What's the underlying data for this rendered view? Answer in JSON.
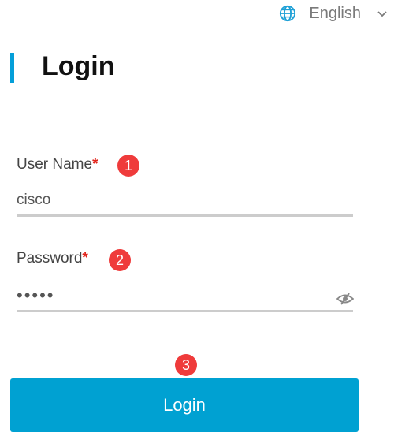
{
  "language": {
    "selected": "English"
  },
  "page": {
    "title": "Login"
  },
  "form": {
    "username": {
      "label": "User Name",
      "required_mark": "*",
      "value": "cisco",
      "step": "1"
    },
    "password": {
      "label": "Password",
      "required_mark": "*",
      "value": "cisco",
      "step": "2"
    },
    "submit": {
      "label": "Login",
      "step": "3"
    }
  },
  "colors": {
    "accent": "#00a1d2",
    "badge": "#ef3b3b",
    "required": "#e2231a"
  }
}
